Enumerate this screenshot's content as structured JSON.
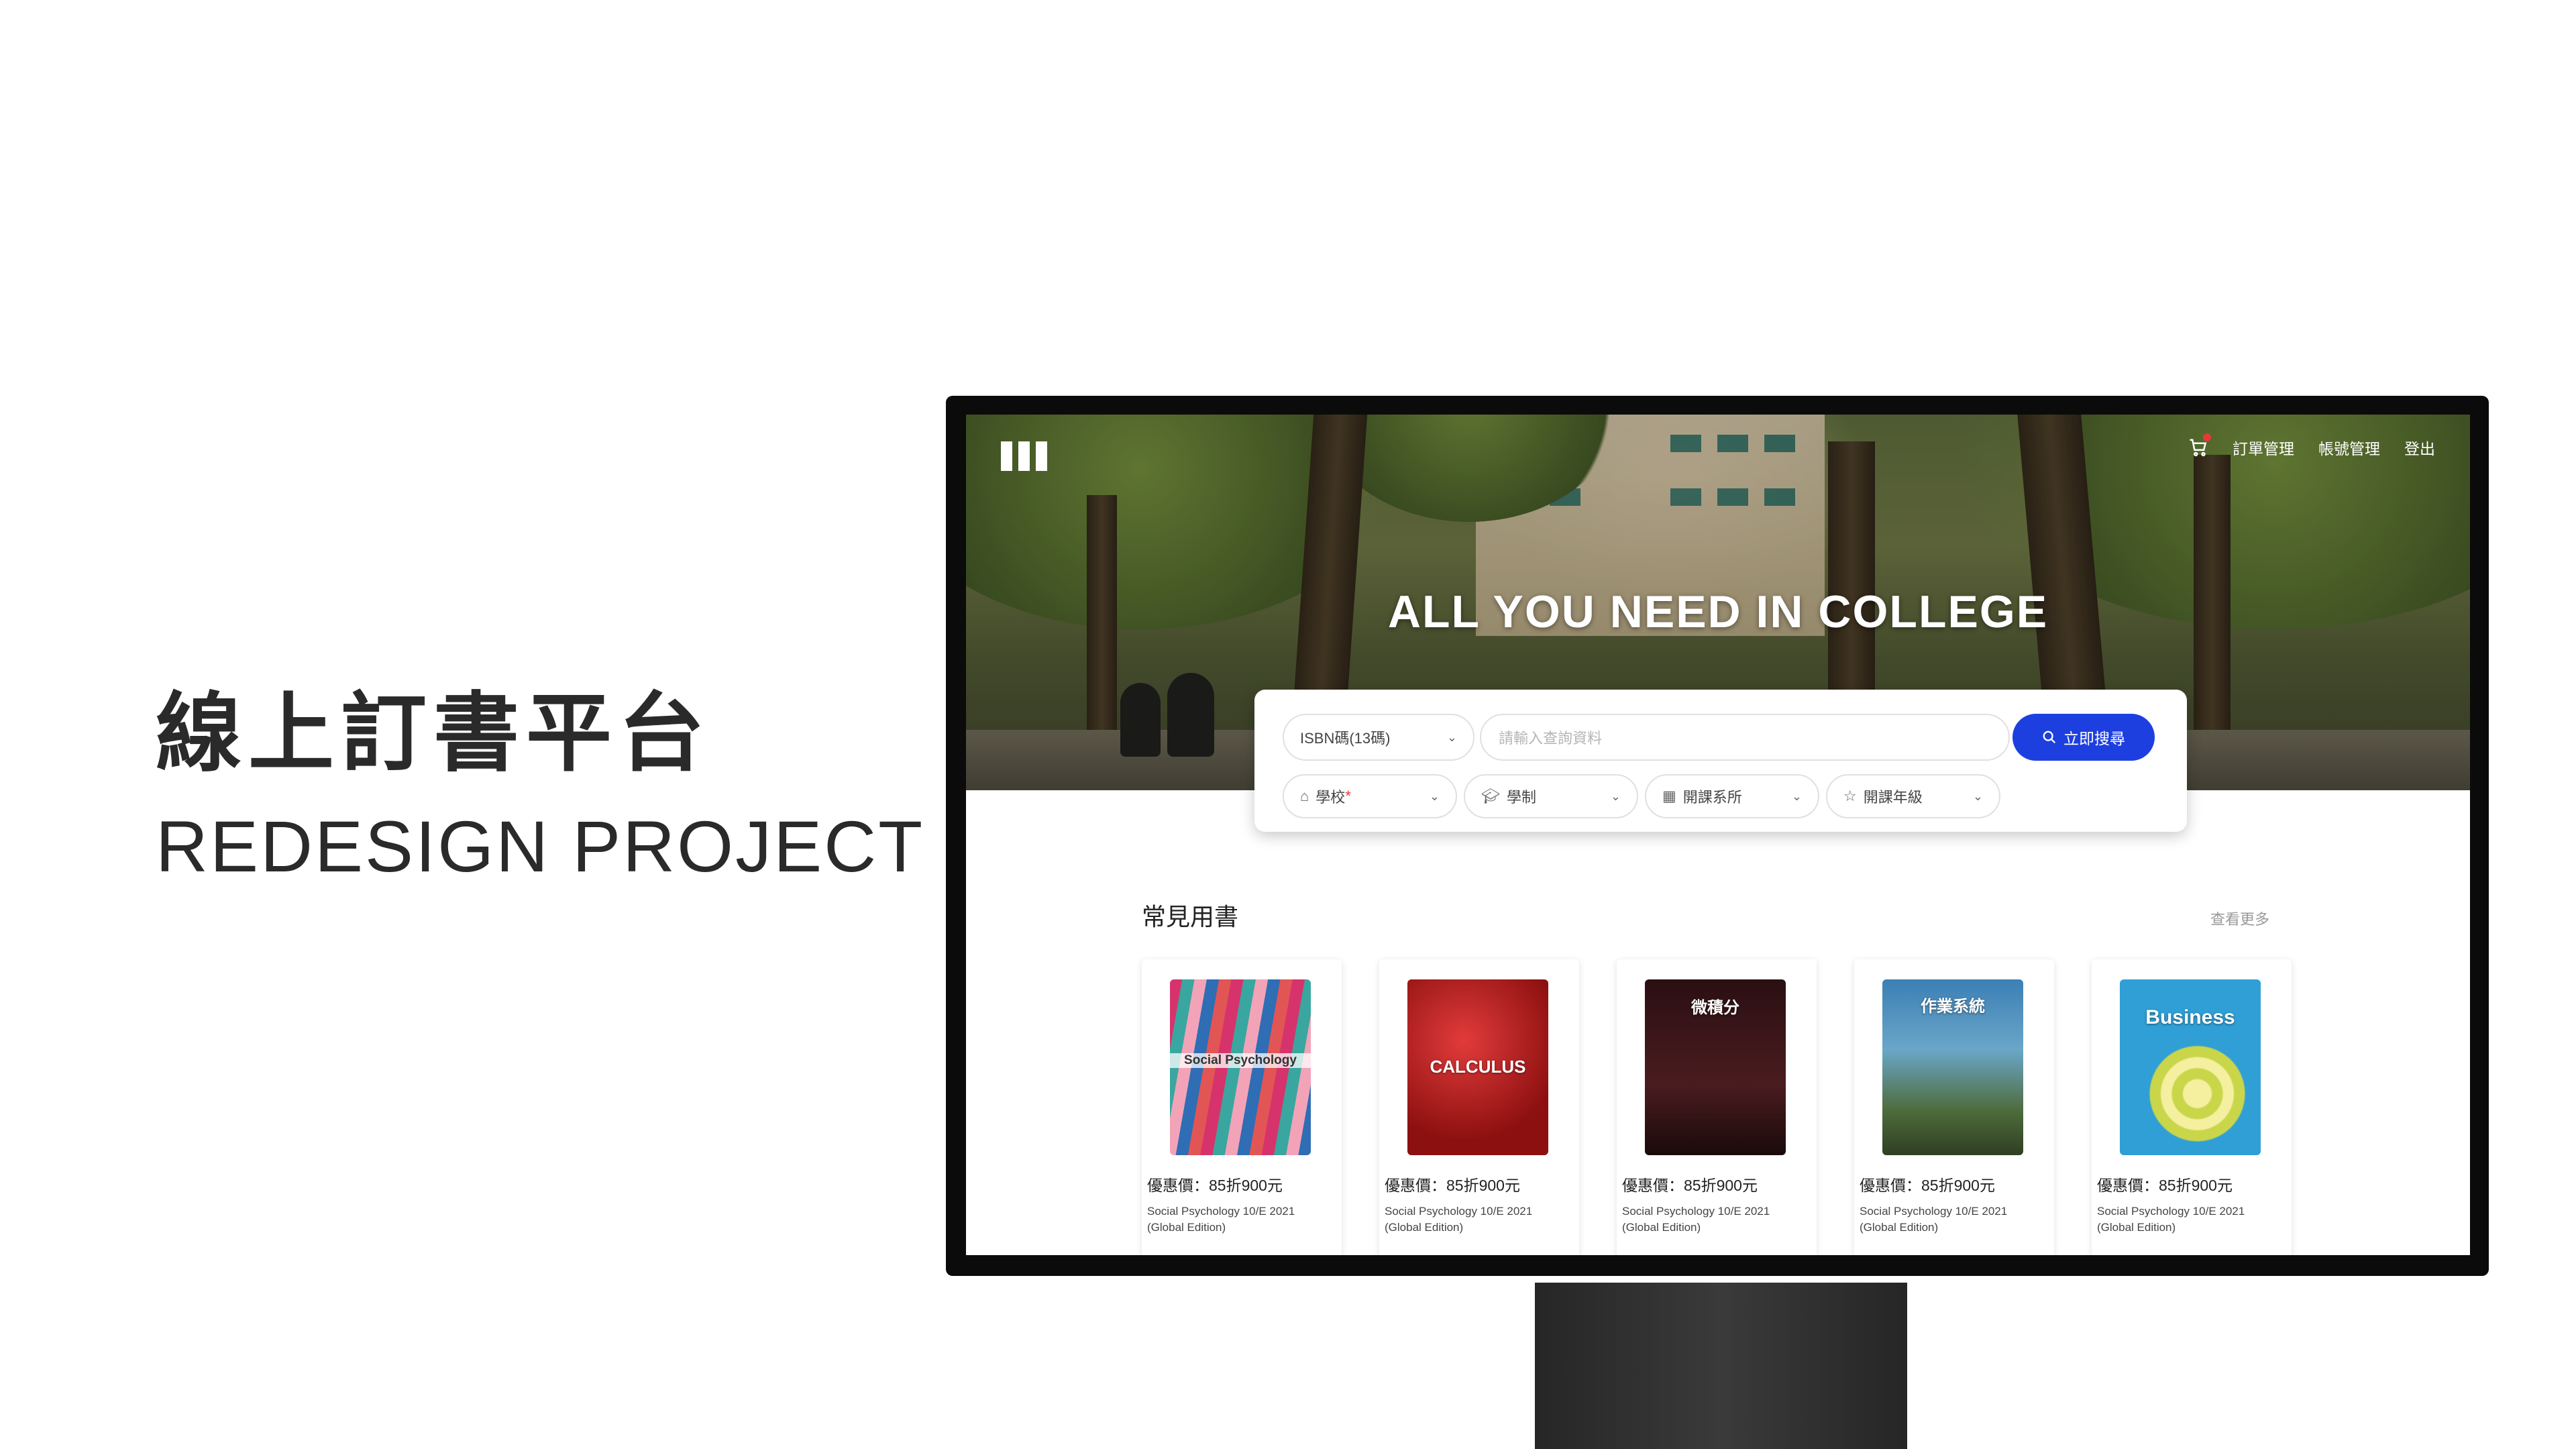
{
  "page": {
    "heading_zh": "線上訂書平台",
    "heading_en": "REDESIGN PROJECT"
  },
  "nav": {
    "items": [
      "訂單管理",
      "帳號管理",
      "登出"
    ]
  },
  "hero": {
    "tagline": "ALL YOU NEED IN COLLEGE"
  },
  "search": {
    "type_select": "ISBN碼(13碼)",
    "placeholder": "請輸入查詢資料",
    "button": "立即搜尋",
    "filters": [
      {
        "label": "學校",
        "required_mark": "*"
      },
      {
        "label": "學制"
      },
      {
        "label": "開課系所"
      },
      {
        "label": "開課年級"
      }
    ]
  },
  "books_section": {
    "title": "常見用書",
    "more": "查看更多",
    "books": [
      {
        "cover_title": "Social Psychology",
        "price": "優惠價：85折900元",
        "name": "Social Psychology 10/E 2021 (Global Edition)"
      },
      {
        "cover_title": "CALCULUS",
        "price": "優惠價：85折900元",
        "name": "Social Psychology 10/E 2021 (Global Edition)"
      },
      {
        "cover_title": "微積分",
        "price": "優惠價：85折900元",
        "name": "Social Psychology 10/E 2021 (Global Edition)"
      },
      {
        "cover_title": "作業系統",
        "price": "優惠價：85折900元",
        "name": "Social Psychology 10/E 2021 (Global Edition)"
      },
      {
        "cover_title": "Business",
        "price": "優惠價：85折900元",
        "name": "Social Psychology 10/E 2021 (Global Edition)"
      }
    ]
  },
  "colors": {
    "accent": "#1e3fe0",
    "badge": "#e53935"
  }
}
